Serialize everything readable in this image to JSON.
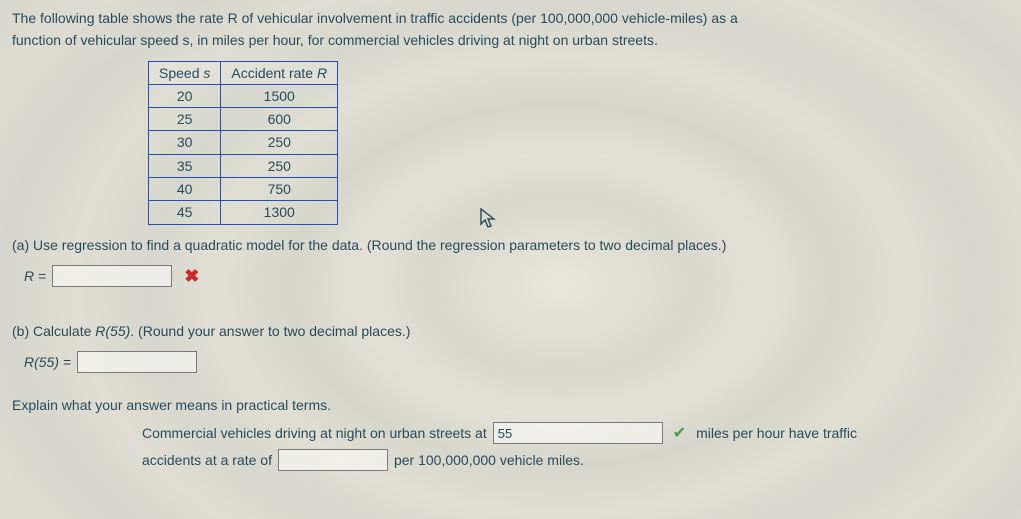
{
  "intro": {
    "line1": "The following table shows the rate R of vehicular involvement in traffic accidents (per 100,000,000 vehicle-miles) as a",
    "line2": "function of vehicular speed s, in miles per hour, for commercial vehicles driving at night on urban streets."
  },
  "table": {
    "headers": {
      "speed_pre": "Speed ",
      "speed_var": "s",
      "rate_pre": "Accident rate ",
      "rate_var": "R"
    },
    "rows": [
      {
        "s": "20",
        "r": "1500"
      },
      {
        "s": "25",
        "r": "600"
      },
      {
        "s": "30",
        "r": "250"
      },
      {
        "s": "35",
        "r": "250"
      },
      {
        "s": "40",
        "r": "750"
      },
      {
        "s": "45",
        "r": "1300"
      }
    ]
  },
  "partA": {
    "prompt": "(a) Use regression to find a quadratic model for the data. (Round the regression parameters to two decimal places.)",
    "lhs_var": "R",
    "lhs_eq": " = ",
    "input_value": ""
  },
  "partB": {
    "prompt_pre": "(b) Calculate  ",
    "prompt_fn": "R(55)",
    "prompt_post": ".  (Round your answer to two decimal places.)",
    "lhs": "R(55) = ",
    "input_value": ""
  },
  "explain": {
    "question": "Explain what your answer means in practical terms.",
    "seg1": "Commercial vehicles driving at night on urban streets at ",
    "input1_value": "55",
    "seg2": " miles per hour have traffic",
    "seg3": "accidents at a rate of ",
    "input2_value": "",
    "seg4": " per 100,000,000 vehicle miles."
  },
  "chart_data": {
    "type": "table",
    "columns": [
      "Speed s",
      "Accident rate R"
    ],
    "rows": [
      [
        20,
        1500
      ],
      [
        25,
        600
      ],
      [
        30,
        250
      ],
      [
        35,
        250
      ],
      [
        40,
        750
      ],
      [
        45,
        1300
      ]
    ]
  }
}
